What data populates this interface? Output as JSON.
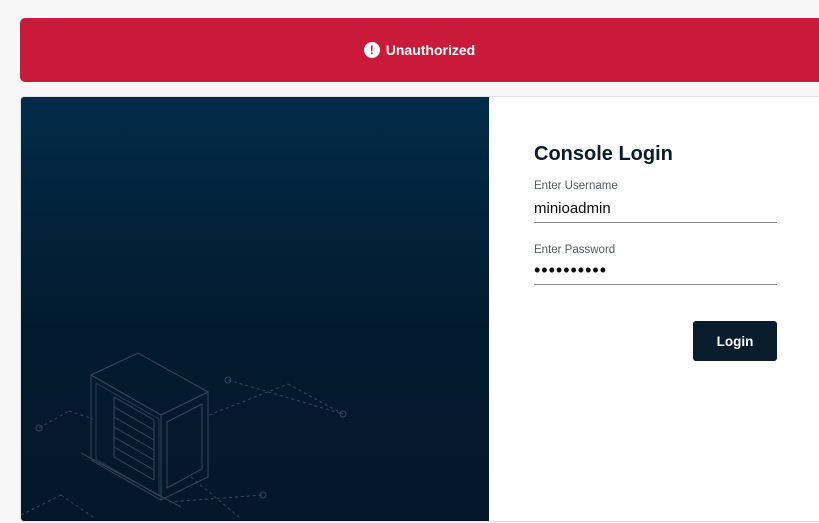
{
  "alert": {
    "icon": "exclamation-circle-icon",
    "icon_glyph": "!",
    "message": "Unauthorized",
    "color": "#c91a3b"
  },
  "login": {
    "title": "Console Login",
    "username_label": "Enter Username",
    "username_value": "minioadmin",
    "password_label": "Enter Password",
    "password_value": "minioadmin",
    "button_label": "Login",
    "button_color": "#081c2e"
  },
  "background": {
    "gradient_top": "#022b49",
    "gradient_bottom": "#04182b",
    "illustration": "server-rack-illustration"
  }
}
